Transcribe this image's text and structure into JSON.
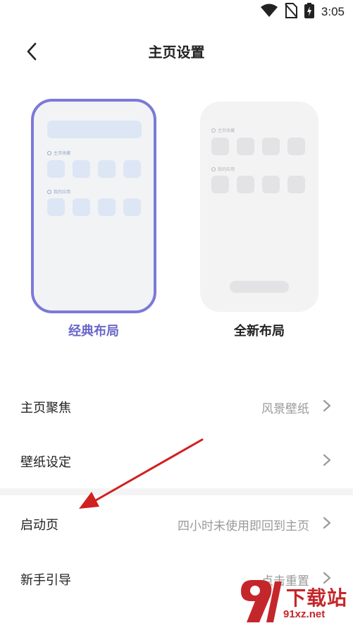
{
  "status_bar": {
    "time": "3:05",
    "icons": [
      "wifi-icon",
      "no-sim-icon",
      "battery-charging-icon"
    ]
  },
  "header": {
    "title": "主页设置",
    "back_icon": "chevron-left-icon"
  },
  "layouts": [
    {
      "label": "经典布局",
      "selected": true,
      "section_1": "主页收藏",
      "section_2": "我的应用"
    },
    {
      "label": "全新布局",
      "selected": false,
      "section_1": "主页收藏",
      "section_2": "我的应用"
    }
  ],
  "settings": [
    {
      "label": "主页聚焦",
      "value": "风景壁纸"
    },
    {
      "label": "壁纸设定",
      "value": ""
    },
    {
      "label": "启动页",
      "value": "四小时未使用即回到主页"
    },
    {
      "label": "新手引导",
      "value": "点击重置"
    }
  ],
  "watermark": {
    "text": "下载站",
    "url": "91xz.net"
  },
  "colors": {
    "accent": "#6b68c9",
    "selected_border": "#7c79d9",
    "annotation_arrow": "#d0201f",
    "watermark": "#c4272b"
  }
}
